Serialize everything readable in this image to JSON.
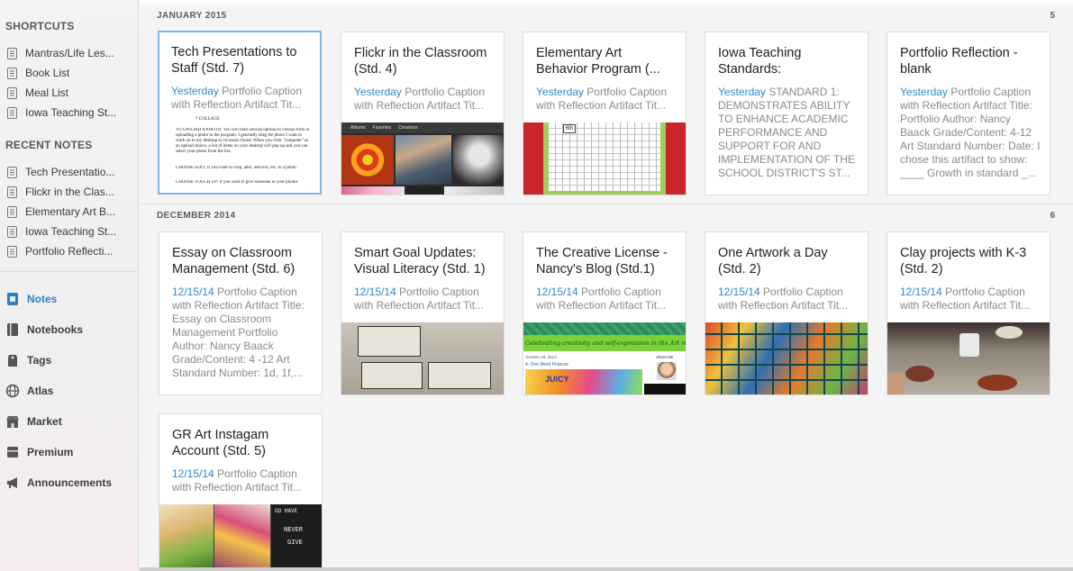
{
  "sidebar": {
    "shortcuts_header": "SHORTCUTS",
    "shortcuts": [
      "Mantras/Life Les...",
      "Book List",
      "Meal List",
      "Iowa Teaching St..."
    ],
    "recent_header": "RECENT NOTES",
    "recent": [
      "Tech Presentatio...",
      "Flickr in the Clas...",
      "Elementary Art B...",
      "Iowa Teaching St...",
      "Portfolio Reflecti..."
    ],
    "nav": [
      {
        "label": "Notes",
        "icon": "notes-icon",
        "active": true
      },
      {
        "label": "Notebooks",
        "icon": "notebooks-icon",
        "active": false
      },
      {
        "label": "Tags",
        "icon": "tags-icon",
        "active": false
      },
      {
        "label": "Atlas",
        "icon": "atlas-icon",
        "active": false
      },
      {
        "label": "Market",
        "icon": "market-icon",
        "active": false
      },
      {
        "label": "Premium",
        "icon": "premium-icon",
        "active": false
      },
      {
        "label": "Announcements",
        "icon": "announcements-icon",
        "active": false
      }
    ]
  },
  "sections": [
    {
      "title": "JANUARY 2015",
      "count": "5",
      "notes": [
        {
          "title": "Tech Presentations to Staff (Std. 7)",
          "date": "Yesterday",
          "snippet": " Portfolio Caption with Reflection Artifact Tit...",
          "thumb": "document"
        },
        {
          "title": "Flickr in the Classroom (Std. 4)",
          "date": "Yesterday",
          "snippet": " Portfolio Caption with Reflection Artifact Tit...",
          "thumb": "photos"
        },
        {
          "title": "Elementary Art Behavior Program (...",
          "date": "Yesterday",
          "snippet": " Portfolio Caption with Reflection Artifact Tit...",
          "thumb": "chart"
        },
        {
          "title": "Iowa Teaching Standards:",
          "date": "Yesterday",
          "snippet": " STANDARD 1: DEMONSTRATES ABILITY TO ENHANCE ACADEMIC PERFORMANCE AND SUPPORT FOR AND IMPLEMENTATION OF THE SCHOOL DISTRICT'S ST...",
          "thumb": "none"
        },
        {
          "title": "Portfolio Reflection - blank",
          "date": "Yesterday",
          "snippet": " Portfolio Caption with Reflection Artifact Title: Portfolio Author: Nancy Baack Grade/Content: 4-12 Art Standard Number: Date: I chose this artifact to show: ____ Growth in standard _...",
          "thumb": "none"
        }
      ]
    },
    {
      "title": "DECEMBER 2014",
      "count": "6",
      "notes": [
        {
          "title": "Essay on Classroom Management (Std. 6)",
          "date": "12/15/14",
          "snippet": " Portfolio Caption with Reflection Artifact Title: Essay on Classroom Management Portfolio Author: Nancy Baack Grade/Content: 4 -12 Art Standard Number: 1d, 1f,...",
          "thumb": "none"
        },
        {
          "title": "Smart Goal Updates: Visual Literacy (Std. 1)",
          "date": "12/15/14",
          "snippet": " Portfolio Caption with Reflection Artifact Tit...",
          "thumb": "worksheet"
        },
        {
          "title": "The Creative License - Nancy's Blog (Std.1)",
          "date": "12/15/14",
          "snippet": " Portfolio Caption with Reflection Artifact Tit...",
          "thumb": "blog"
        },
        {
          "title": "One Artwork a Day (Std. 2)",
          "date": "12/15/14",
          "snippet": " Portfolio Caption with Reflection Artifact Tit...",
          "thumb": "artwall"
        },
        {
          "title": "Clay projects with K-3 (Std. 2)",
          "date": "12/15/14",
          "snippet": " Portfolio Caption with Reflection Artifact Tit...",
          "thumb": "clay"
        },
        {
          "title": "GR Art Instagam Account (Std. 5)",
          "date": "12/15/14",
          "snippet": " Portfolio Caption with Reflection Artifact Tit...",
          "thumb": "instagram"
        }
      ]
    }
  ],
  "thumb_text": {
    "flickr_tabs": [
      "Albums",
      "Favorites",
      "Creations"
    ],
    "doc_lines": [
      "* COLLAGE",
      "TO UPLOAD A PHOTO: You will have several options to choose from in uploading a photo to the program. I generally drag the photo I want to work on to my desktop so its easily found. When you click \"computer\" as an upload choice, a list of items on your desktop will pop up and you can select your photo from the list.",
      "CHOOSE EDIT: if you want to crop, alter, add text, etc. to a photo.",
      "CHOOSE TOUCH UP: if you want to give someone in your photos"
    ],
    "chart_label": "6th",
    "blog_banner": "Celebrating creativity and self-expression in the Art room!",
    "blog_date": "October 28, 2014",
    "blog_post": "4: One Word Projects",
    "blog_about": "About Me",
    "blog_juicy": "JUICY",
    "insta_words": [
      "GO HAVE",
      "NEVER",
      "GIVE"
    ]
  },
  "colors": {
    "accent": "#2f86d1",
    "selected_border": "#7fb6e6",
    "snippet": "#8a8a8a",
    "background": "#f4f4f4"
  }
}
